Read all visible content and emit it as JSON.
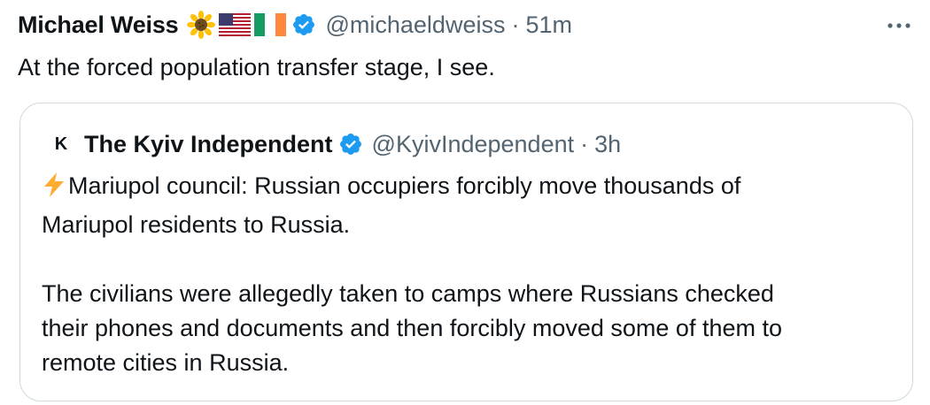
{
  "tweet": {
    "author": {
      "name": "Michael Weiss",
      "emojis": [
        "sunflower-icon",
        "us-flag-icon",
        "ireland-flag-icon"
      ],
      "verified": true,
      "handle": "@michaeldweiss",
      "separator": "·",
      "time": "51m"
    },
    "text": "At the forced population transfer stage, I see.",
    "quote": {
      "avatar_letter": "K",
      "name": "The Kyiv Independent",
      "verified": true,
      "handle": "@KyivIndependent",
      "separator": "·",
      "time": "3h",
      "paragraphs": [
        [
          "Mariupol council: Russian occupiers forcibly move thousands of",
          "Mariupol residents to Russia."
        ],
        [
          "The civilians were allegedly taken to camps where Russians checked",
          "their phones and documents and then forcibly moved some of them to",
          "remote cities in Russia."
        ]
      ]
    }
  },
  "colors": {
    "text": "#0f1419",
    "secondary": "#536471",
    "verified": "#1d9bf0",
    "border": "#cfd9de"
  }
}
